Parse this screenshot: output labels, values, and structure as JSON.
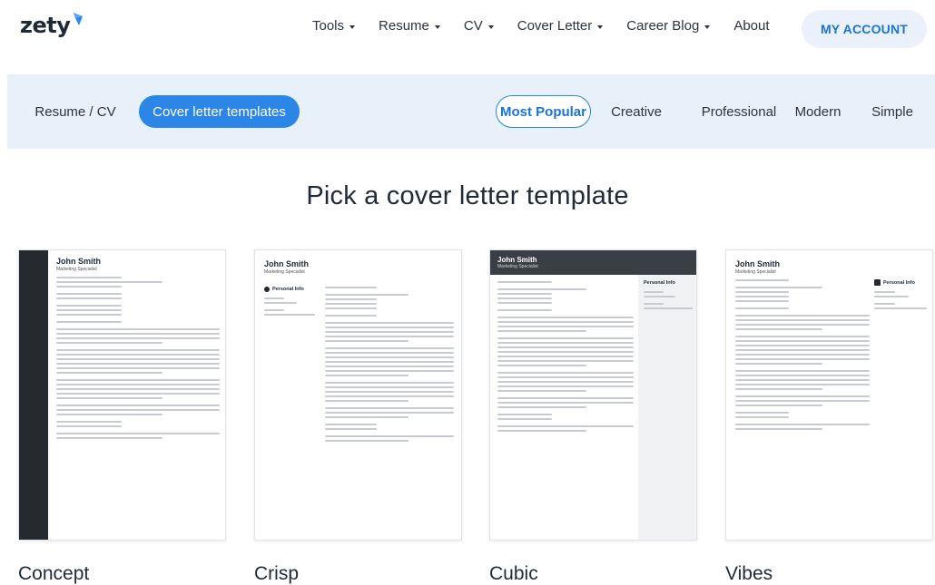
{
  "header": {
    "logo_text": "zety",
    "brand_color": "#2b86e8",
    "nav": [
      {
        "label": "Tools",
        "has_dropdown": true
      },
      {
        "label": "Resume",
        "has_dropdown": true
      },
      {
        "label": "CV",
        "has_dropdown": true
      },
      {
        "label": "Cover Letter",
        "has_dropdown": true
      },
      {
        "label": "Career Blog",
        "has_dropdown": true
      },
      {
        "label": "About",
        "has_dropdown": false
      }
    ],
    "account_button": "MY ACCOUNT"
  },
  "filters": {
    "types": [
      {
        "label": "Resume / CV",
        "active": false
      },
      {
        "label": "Cover letter templates",
        "active": true
      }
    ],
    "styles": [
      {
        "label": "Most Popular",
        "active": true
      },
      {
        "label": "Creative",
        "active": false
      },
      {
        "label": "Professional",
        "active": false
      },
      {
        "label": "Modern",
        "active": false
      },
      {
        "label": "Simple",
        "active": false
      }
    ]
  },
  "page_title": "Pick a cover letter template",
  "templates": [
    {
      "name": "Concept",
      "preview": {
        "person": "John Smith",
        "role": "Marketing Specialist"
      }
    },
    {
      "name": "Crisp",
      "preview": {
        "person": "John Smith",
        "role": "Marketing Specialist",
        "section": "Personal Info"
      }
    },
    {
      "name": "Cubic",
      "preview": {
        "person": "John Smith",
        "role": "Marketing Specialist",
        "section": "Personal Info"
      }
    },
    {
      "name": "Vibes",
      "preview": {
        "person": "John Smith",
        "role": "Marketing Specialist",
        "section": "Personal Info"
      }
    }
  ]
}
